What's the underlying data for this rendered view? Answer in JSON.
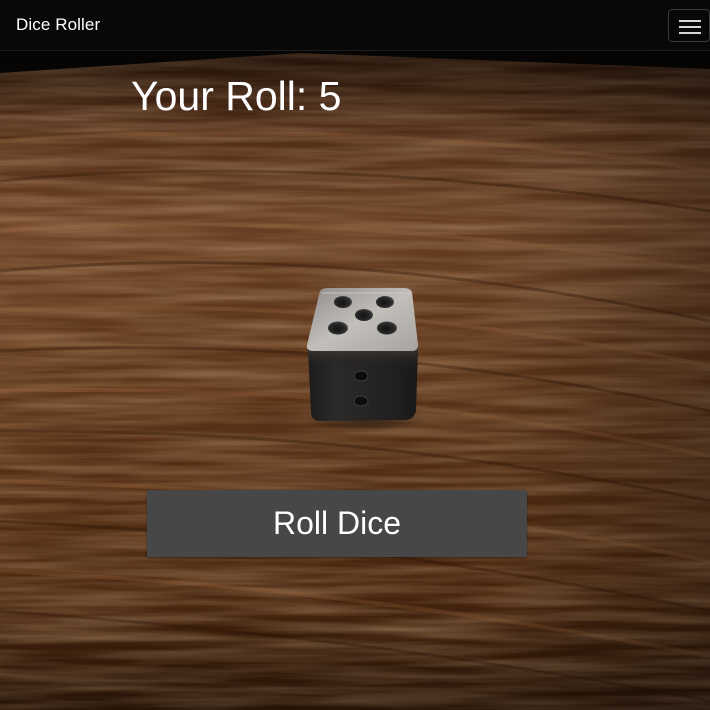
{
  "navbar": {
    "brand": "Dice Roller",
    "menu_icon": "hamburger-menu-icon"
  },
  "result": {
    "label": "Your Roll: 5",
    "value": 5
  },
  "die": {
    "top_face": 5,
    "front_face": 2,
    "face_color": "#9b9795",
    "pip_color": "#1a1a1a"
  },
  "actions": {
    "roll_label": "Roll Dice"
  },
  "colors": {
    "navbar_bg": "#080808",
    "wood_light": "#8a5a38",
    "wood_dark": "#2e170a",
    "button_bg": "#474747"
  }
}
